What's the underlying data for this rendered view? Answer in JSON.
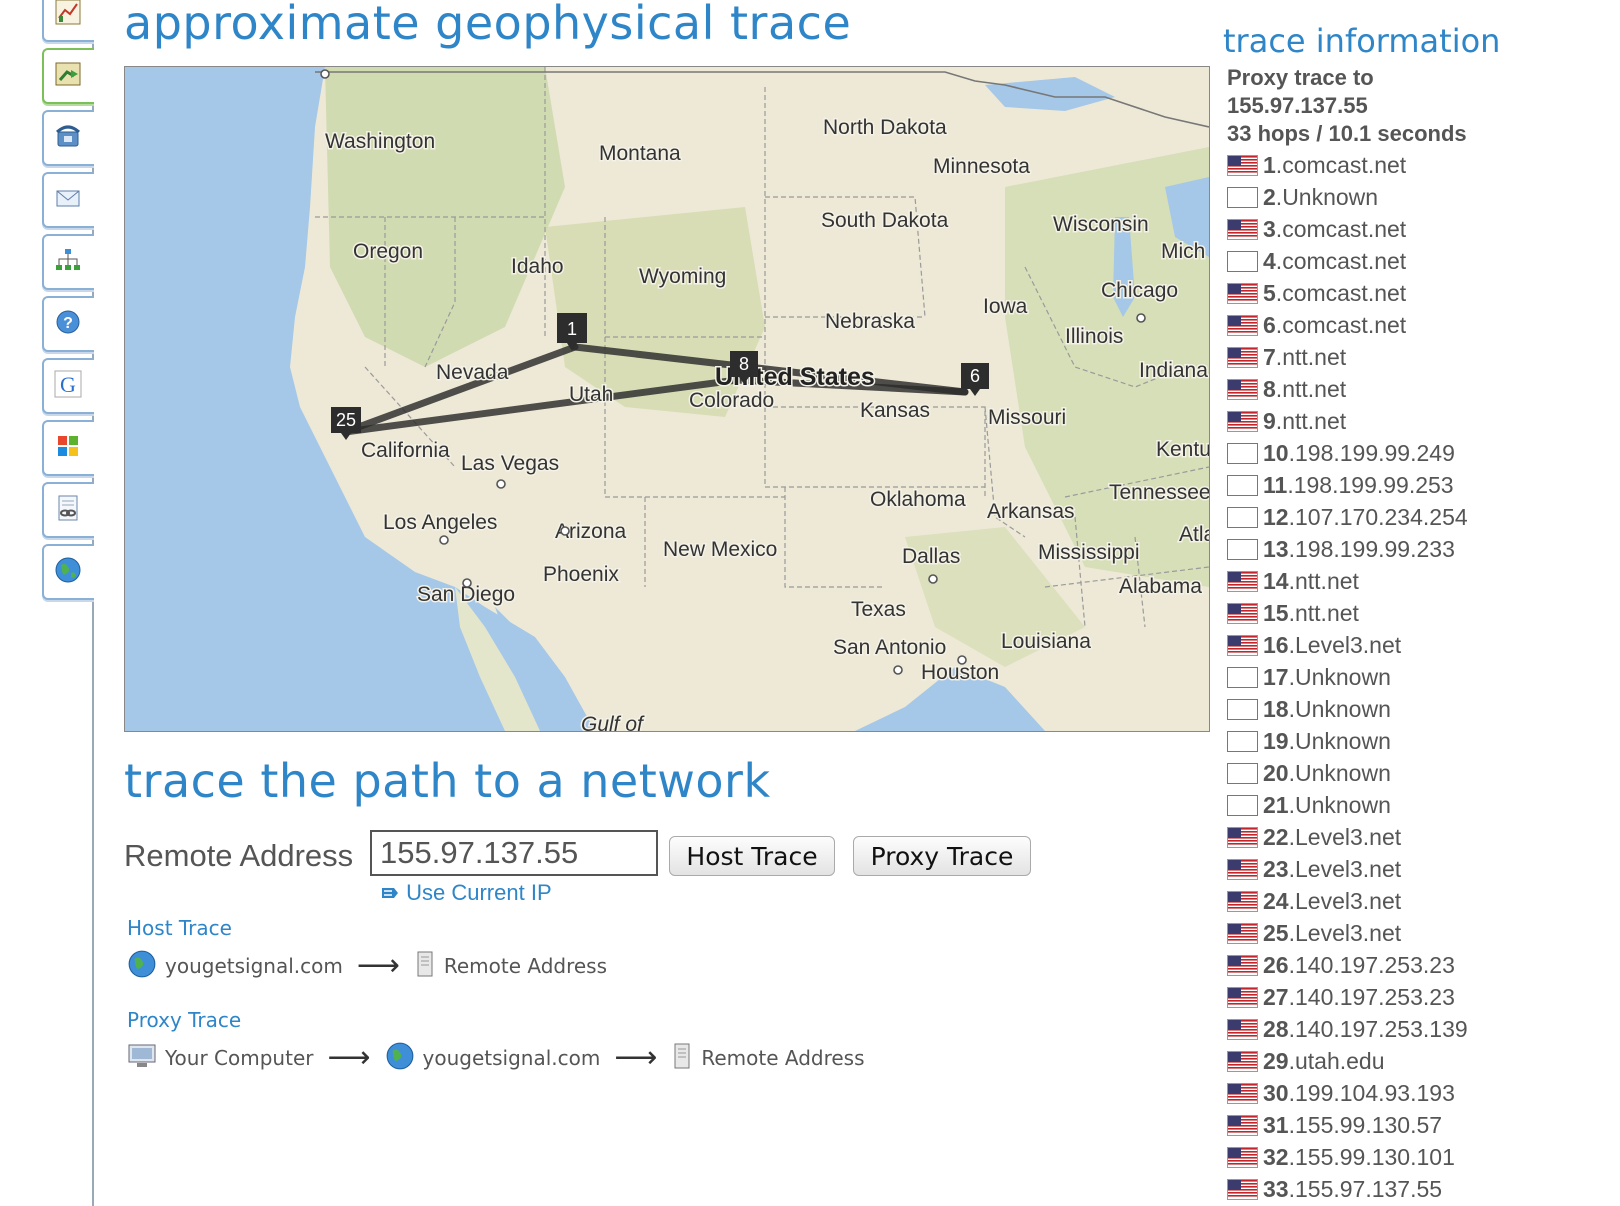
{
  "titles": {
    "map_section": "approximate geophysical trace",
    "form_section": "trace the path to a network",
    "info_section": "trace information"
  },
  "rail": {
    "icons": [
      "chart-icon",
      "map-route-icon",
      "phone-icon",
      "mail-icon",
      "network-icon",
      "help-icon",
      "google-icon",
      "windows-icon",
      "document-link-icon",
      "globe-icon"
    ],
    "active_index": 1
  },
  "map": {
    "country": "United States",
    "states": [
      "Washington",
      "Montana",
      "North Dakota",
      "Minnesota",
      "South Dakota",
      "Wisconsin",
      "Mich",
      "Oregon",
      "Idaho",
      "Wyoming",
      "Iowa",
      "Chicago",
      "Nebraska",
      "Illinois",
      "Indiana",
      "Nevada",
      "Utah",
      "Colorado",
      "Kansas",
      "Missouri",
      "California",
      "Las Vegas",
      "Kentu",
      "Tennessee",
      "Los Angeles",
      "Arizona",
      "Oklahoma",
      "Arkansas",
      "Atla",
      "New Mexico",
      "Dallas",
      "Mississippi",
      "Phoenix",
      "San Diego",
      "Alabama",
      "Texas",
      "Louisiana",
      "San Antonio",
      "Houston",
      "Gulf of"
    ],
    "hop_markers": [
      "1",
      "8",
      "6",
      "25"
    ]
  },
  "form": {
    "remote_label": "Remote Address",
    "remote_value": "155.97.137.55",
    "host_button": "Host Trace",
    "proxy_button": "Proxy Trace",
    "use_current_ip": "Use Current IP"
  },
  "legend": {
    "host_title": "Host Trace",
    "host_steps": [
      "yougetsignal.com",
      "Remote Address"
    ],
    "proxy_title": "Proxy Trace",
    "proxy_steps": [
      "Your Computer",
      "yougetsignal.com",
      "Remote Address"
    ]
  },
  "info": {
    "line1": "Proxy trace to",
    "line2": "155.97.137.55",
    "line3": "33 hops / 10.1 seconds",
    "hops": [
      {
        "n": "1",
        "host": "comcast.net",
        "flag": "us"
      },
      {
        "n": "2",
        "host": "Unknown",
        "flag": "none"
      },
      {
        "n": "3",
        "host": "comcast.net",
        "flag": "us"
      },
      {
        "n": "4",
        "host": "comcast.net",
        "flag": "none"
      },
      {
        "n": "5",
        "host": "comcast.net",
        "flag": "us"
      },
      {
        "n": "6",
        "host": "comcast.net",
        "flag": "us"
      },
      {
        "n": "7",
        "host": "ntt.net",
        "flag": "us"
      },
      {
        "n": "8",
        "host": "ntt.net",
        "flag": "us"
      },
      {
        "n": "9",
        "host": "ntt.net",
        "flag": "us"
      },
      {
        "n": "10",
        "host": "198.199.99.249",
        "flag": "none"
      },
      {
        "n": "11",
        "host": "198.199.99.253",
        "flag": "none"
      },
      {
        "n": "12",
        "host": "107.170.234.254",
        "flag": "none"
      },
      {
        "n": "13",
        "host": "198.199.99.233",
        "flag": "none"
      },
      {
        "n": "14",
        "host": "ntt.net",
        "flag": "us"
      },
      {
        "n": "15",
        "host": "ntt.net",
        "flag": "us"
      },
      {
        "n": "16",
        "host": "Level3.net",
        "flag": "us"
      },
      {
        "n": "17",
        "host": "Unknown",
        "flag": "none"
      },
      {
        "n": "18",
        "host": "Unknown",
        "flag": "none"
      },
      {
        "n": "19",
        "host": "Unknown",
        "flag": "none"
      },
      {
        "n": "20",
        "host": "Unknown",
        "flag": "none"
      },
      {
        "n": "21",
        "host": "Unknown",
        "flag": "none"
      },
      {
        "n": "22",
        "host": "Level3.net",
        "flag": "us"
      },
      {
        "n": "23",
        "host": "Level3.net",
        "flag": "us"
      },
      {
        "n": "24",
        "host": "Level3.net",
        "flag": "us"
      },
      {
        "n": "25",
        "host": "Level3.net",
        "flag": "us"
      },
      {
        "n": "26",
        "host": "140.197.253.23",
        "flag": "us"
      },
      {
        "n": "27",
        "host": "140.197.253.23",
        "flag": "us"
      },
      {
        "n": "28",
        "host": "140.197.253.139",
        "flag": "us"
      },
      {
        "n": "29",
        "host": "utah.edu",
        "flag": "us"
      },
      {
        "n": "30",
        "host": "199.104.93.193",
        "flag": "us"
      },
      {
        "n": "31",
        "host": "155.99.130.57",
        "flag": "us"
      },
      {
        "n": "32",
        "host": "155.99.130.101",
        "flag": "us"
      },
      {
        "n": "33",
        "host": "155.97.137.55",
        "flag": "us"
      }
    ]
  },
  "colors": {
    "accent": "#2e86c8",
    "land": "#ede9d6",
    "water": "#a5c7e8",
    "route": "#2b2b2b"
  }
}
